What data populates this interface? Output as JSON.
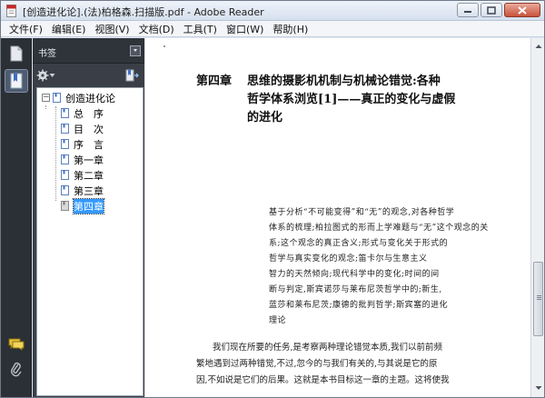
{
  "window": {
    "title": "[创造进化论].(法)柏格森.扫描版.pdf - Adobe Reader"
  },
  "menu": {
    "items": [
      "文件(F)",
      "编辑(E)",
      "视图(V)",
      "文档(D)",
      "工具(T)",
      "窗口(W)",
      "帮助(H)"
    ]
  },
  "panel": {
    "title": "书签"
  },
  "bookmarks": {
    "root": "创造进化论",
    "children": [
      "总　序",
      "目　次",
      "序　言",
      "第一章",
      "第二章",
      "第三章",
      "第四章"
    ],
    "selected_index": 6
  },
  "document": {
    "chapter_number": "第四章",
    "heading_lines": [
      "思维的摄影机机制与机械论错觉:各种",
      "哲学体系浏览[1]——真正的变化与虚假",
      "的进化"
    ],
    "quote_lines": [
      "基于分析“不可能变得”和“无”的观念,对各种哲学",
      "体系的梳理;柏拉图式的形而上学难题与“无”这个观念的关",
      "系;这个观念的真正含义;形式与变化关于形式的",
      "哲学与真实变化的观念;笛卡尔与生意主义",
      "智力的天然倾向;现代科学中的变化;时间的间",
      "断与判定,斯宾诺莎与莱布尼茨哲学中的;新生,",
      "蓝莎和莱布尼茨;康德的批判哲学;斯宾塞的进化",
      "理论"
    ],
    "body_lines": [
      "我们现在所要的任务,是考察两种理论错觉本质,我们以前前频",
      "繁地遇到过两种错觉,不过,忽今的与我们有关的,与其说是它的原",
      "因,不如说是它们的后果。这就是本书目标这一章的主题。这将使我"
    ]
  },
  "icons": {
    "app": "pdf-document-icon",
    "pages_panel": "pages-icon",
    "bookmarks_panel": "bookmarks-icon",
    "comments": "comment-icon",
    "attachments": "paperclip-icon"
  },
  "colors": {
    "selection": "#3399ff",
    "sidebar_dark": "#2b2f36",
    "panel_bg": "#3a3f47"
  }
}
